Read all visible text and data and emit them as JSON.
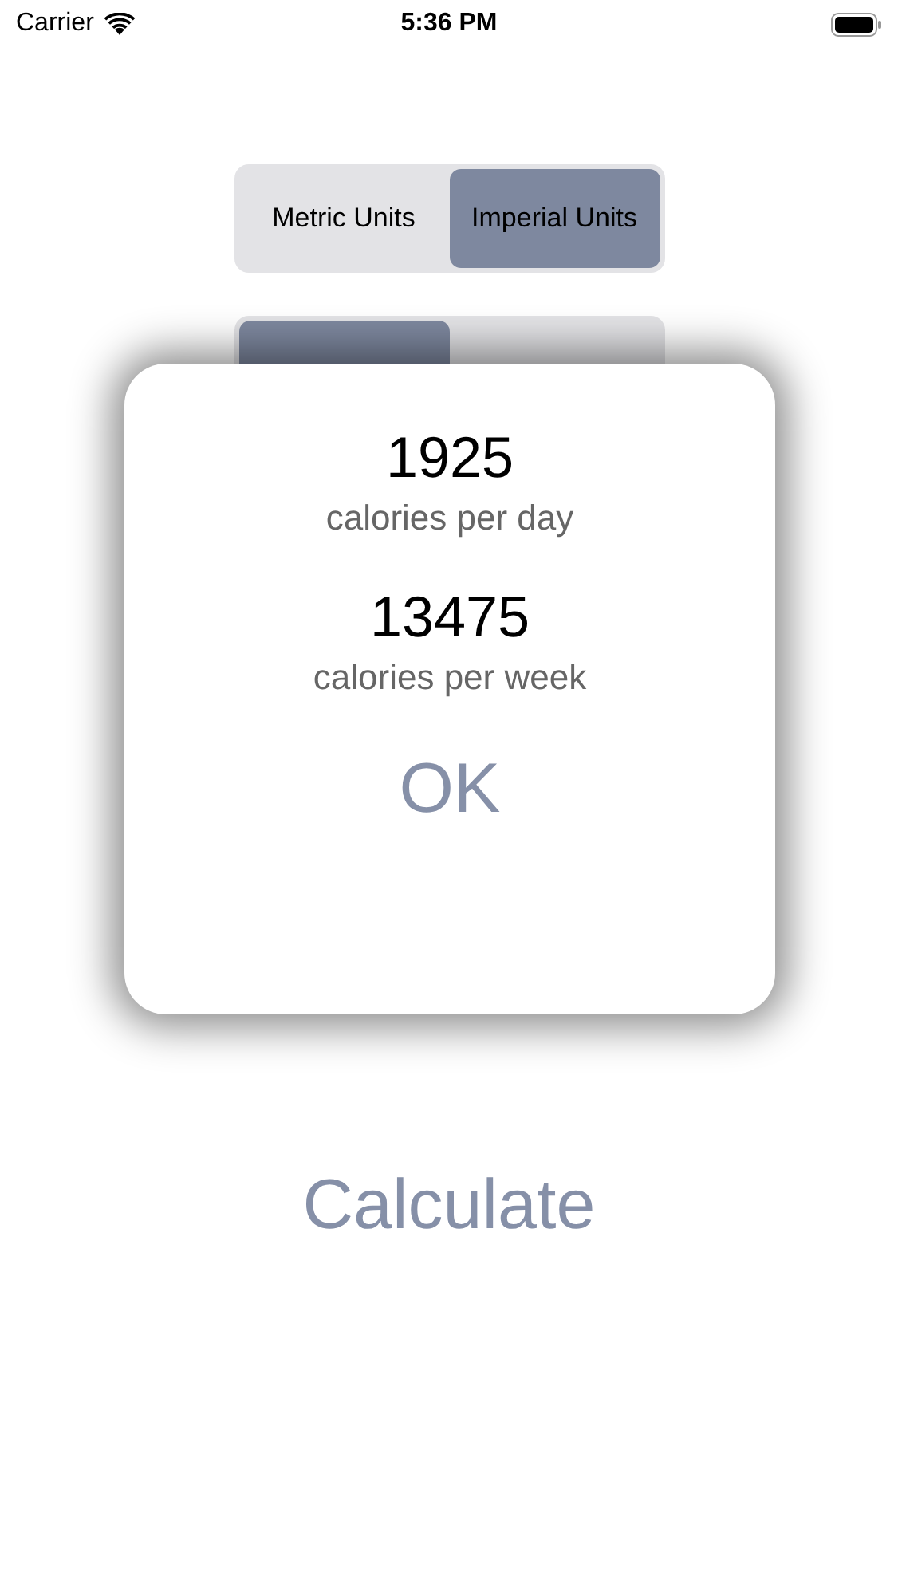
{
  "status_bar": {
    "carrier": "Carrier",
    "time": "5:36 PM"
  },
  "unit_selector": [
    {
      "label": "Metric Units",
      "selected": false
    },
    {
      "label": "Imperial Units",
      "selected": true
    }
  ],
  "gender_selector": [
    {
      "selected": true
    },
    {
      "selected": false
    }
  ],
  "calculate_button": "Calculate",
  "result_dialog": {
    "results": [
      {
        "value": "1925",
        "caption": "calories per day"
      },
      {
        "value": "13475",
        "caption": "calories per week"
      }
    ],
    "button": "OK"
  }
}
